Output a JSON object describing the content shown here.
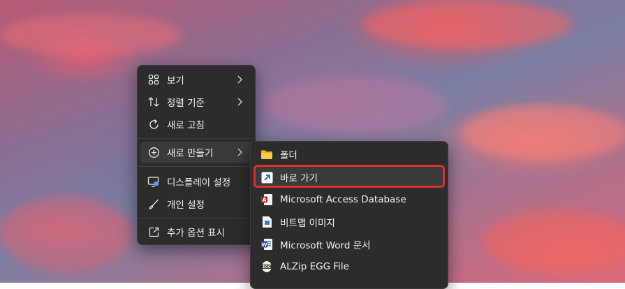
{
  "main_menu": {
    "items": [
      {
        "label": "보기",
        "icon": "grid-icon",
        "submenu": true
      },
      {
        "label": "정렬 기준",
        "icon": "sort-icon",
        "submenu": true
      },
      {
        "label": "새로 고침",
        "icon": "refresh-icon",
        "submenu": false
      },
      {
        "label": "새로 만들기",
        "icon": "plus-circle-icon",
        "submenu": true,
        "hovered": true
      },
      {
        "label": "디스플레이 설정",
        "icon": "display-icon",
        "submenu": false
      },
      {
        "label": "개인 설정",
        "icon": "brush-icon",
        "submenu": false
      },
      {
        "label": "추가 옵션 표시",
        "icon": "external-link-icon",
        "submenu": false
      }
    ]
  },
  "sub_menu": {
    "items": [
      {
        "label": "폴더",
        "icon": "folder-icon"
      },
      {
        "label": "바로 가기",
        "icon": "shortcut-icon",
        "highlighted": true
      },
      {
        "label": "Microsoft Access Database",
        "icon": "access-icon"
      },
      {
        "label": "비트맵 이미지",
        "icon": "bitmap-icon"
      },
      {
        "label": "Microsoft Word 문서",
        "icon": "word-icon"
      },
      {
        "label": "ALZip EGG File",
        "icon": "egg-icon"
      }
    ]
  },
  "colors": {
    "menu_bg": "#2c2c2c",
    "hover_bg": "#3a3a3a",
    "highlight_border": "#d9342b",
    "folder": "#f2c14b",
    "shortcut": "#4aa3ff"
  }
}
